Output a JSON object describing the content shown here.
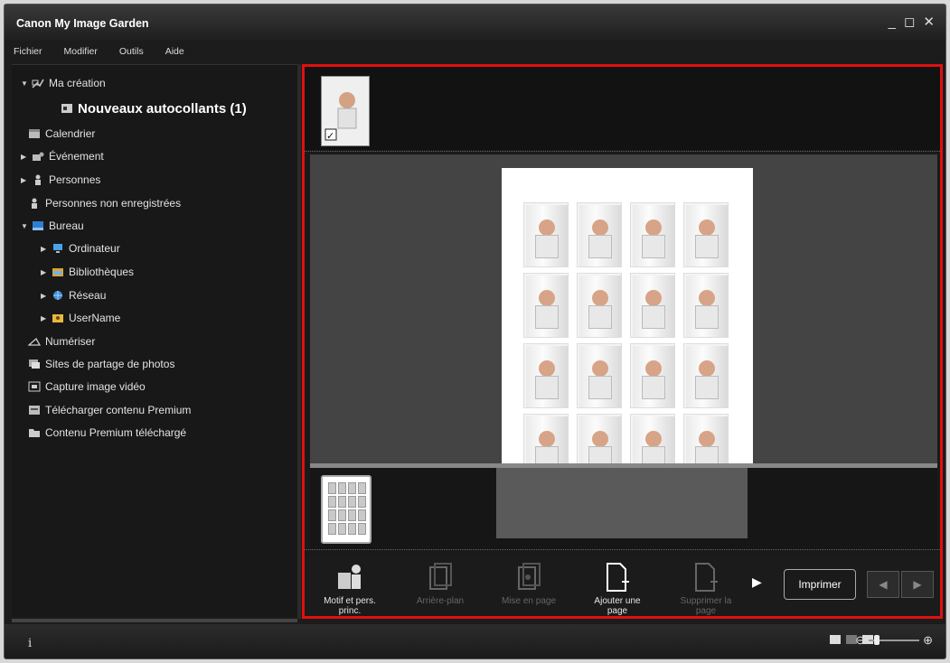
{
  "window": {
    "title": "Canon My Image Garden",
    "controls": {
      "minimize": "_",
      "maximize": "◻",
      "close": "✕"
    }
  },
  "menu": [
    "Fichier",
    "Modifier",
    "Outils",
    "Aide"
  ],
  "sidebar": {
    "items": [
      {
        "label": "Ma création",
        "expanded": "▼"
      },
      {
        "label": "Nouveaux autocollants (1)"
      },
      {
        "label": "Calendrier"
      },
      {
        "label": "Événement",
        "expanded": "▶"
      },
      {
        "label": "Personnes",
        "expanded": "▶"
      },
      {
        "label": "Personnes non enregistrées"
      },
      {
        "label": "Bureau",
        "expanded": "▼"
      },
      {
        "label": "Ordinateur",
        "expanded": "▶"
      },
      {
        "label": "Bibliothèques",
        "expanded": "▶"
      },
      {
        "label": "Réseau",
        "expanded": "▶"
      },
      {
        "label": "UserName",
        "expanded": "▶"
      },
      {
        "label": "Numériser"
      },
      {
        "label": "Sites de partage de photos"
      },
      {
        "label": "Capture image vidéo"
      },
      {
        "label": "Télécharger contenu Premium"
      },
      {
        "label": "Contenu Premium téléchargé"
      }
    ]
  },
  "thumb_check": "✓",
  "toolbar": {
    "tools": [
      {
        "label": "Motif et pers. princ.",
        "enabled": true
      },
      {
        "label": "Arrière-plan",
        "enabled": false
      },
      {
        "label": "Mise en page",
        "enabled": false
      },
      {
        "label": "Ajouter une page",
        "enabled": true
      },
      {
        "label": "Supprimer la page",
        "enabled": false
      }
    ],
    "more": "▶",
    "print_label": "Imprimer",
    "prev": "◀",
    "next": "▶"
  },
  "status": {
    "info": "i",
    "zoom_out": "⊖",
    "zoom_in": "⊕"
  }
}
